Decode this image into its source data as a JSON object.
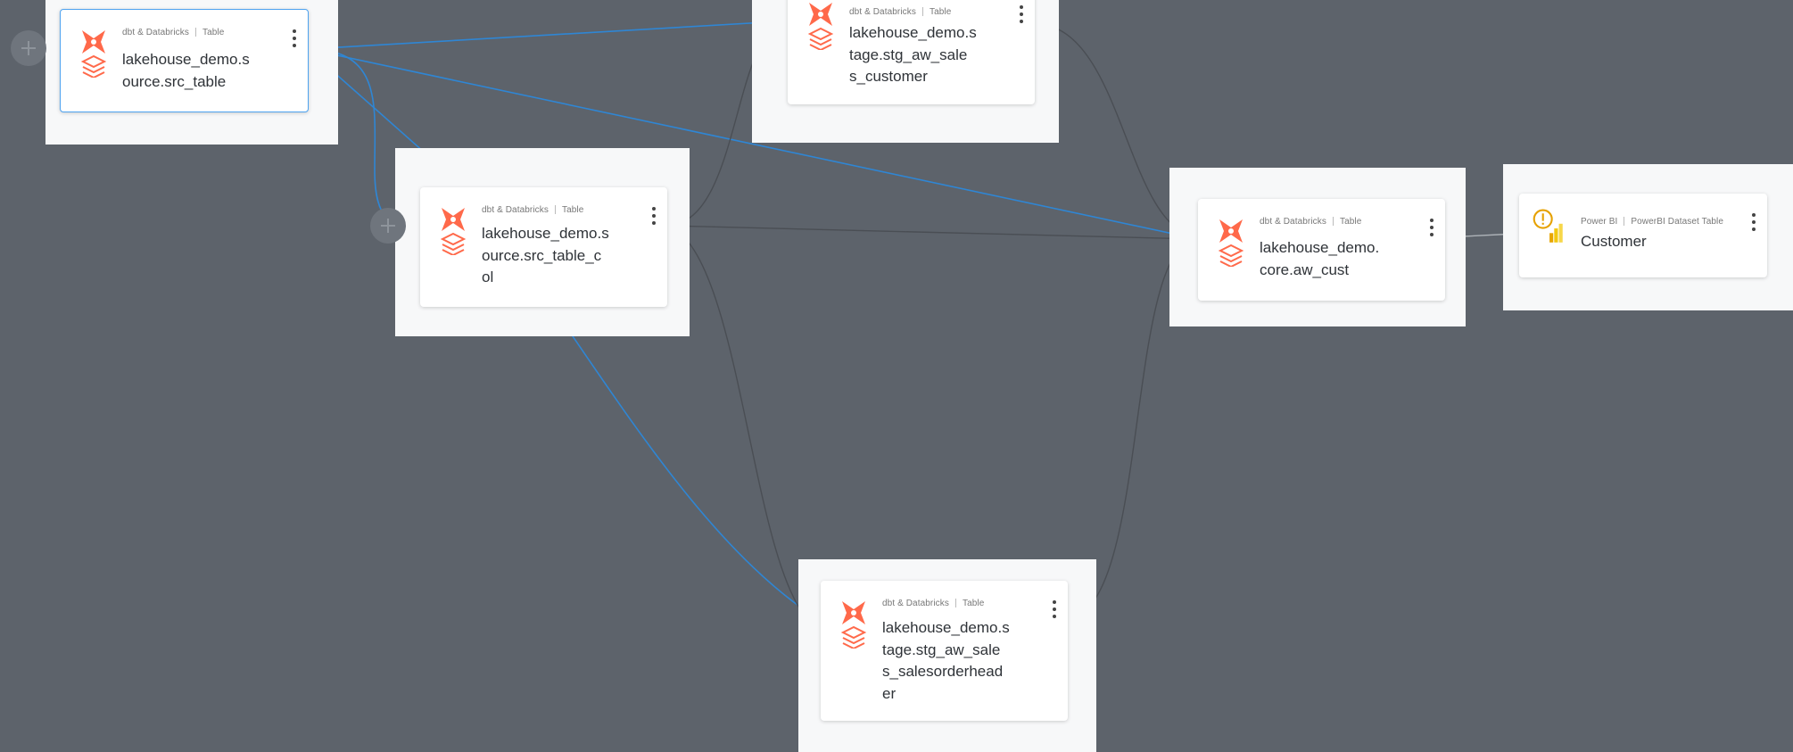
{
  "nodes": {
    "src_table": {
      "platform": "dbt & Databricks",
      "type": "Table",
      "name_lines": [
        "lakehouse_demo.s",
        "ource.src_table"
      ]
    },
    "stg_customer": {
      "platform": "dbt & Databricks",
      "type": "Table",
      "name_lines": [
        "lakehouse_demo.s",
        "tage.stg_aw_sale",
        "s_customer"
      ]
    },
    "src_table_col": {
      "platform": "dbt & Databricks",
      "type": "Table",
      "name_lines": [
        "lakehouse_demo.s",
        "ource.src_table_c",
        "ol"
      ]
    },
    "aw_cust": {
      "platform": "dbt & Databricks",
      "type": "Table",
      "name_lines": [
        "lakehouse_demo.",
        "core.aw_cust"
      ]
    },
    "customer_pbi": {
      "platform": "Power BI",
      "type": "PowerBI Dataset Table",
      "name_lines": [
        "Customer"
      ]
    },
    "stg_salesorderheader": {
      "platform": "dbt & Databricks",
      "type": "Table",
      "name_lines": [
        "lakehouse_demo.s",
        "tage.stg_aw_sale",
        "s_salesorderhead",
        "er"
      ]
    }
  },
  "icons": {
    "dbt_logo": "dbt-logo-icon",
    "databricks_logo": "databricks-stack-icon",
    "warning": "warning-circle-icon",
    "powerbi_logo": "powerbi-icon",
    "kebab": "kebab-menu-icon",
    "expand": "plus-icon"
  },
  "colors": {
    "canvas": "#5d636b",
    "group_bg": "#f7f8f9",
    "card_bg": "#ffffff",
    "highlight_edge": "#2f86d4",
    "edge": "#4a4e54",
    "dbt_orange": "#ff694a",
    "warning": "#e6a100",
    "powerbi_yellow": "#f2c811"
  }
}
